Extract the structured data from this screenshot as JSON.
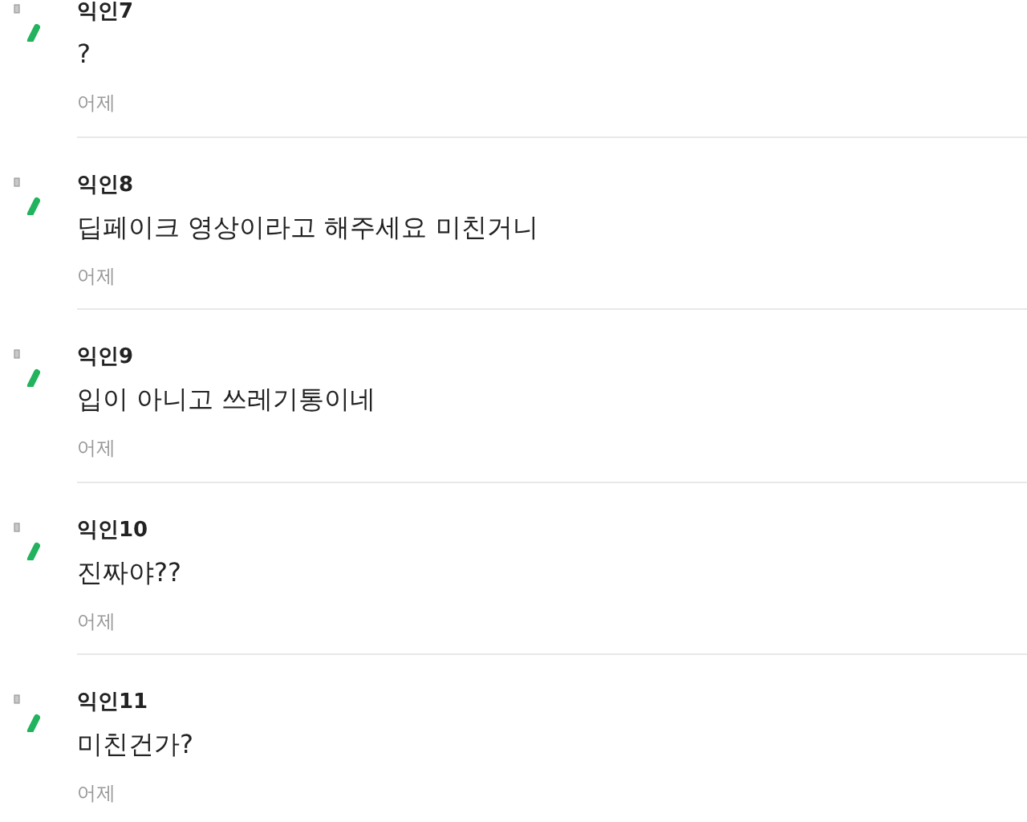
{
  "comments": [
    {
      "author": "익인7",
      "text": "?",
      "time": "어제"
    },
    {
      "author": "익인8",
      "text": "딥페이크 영상이라고 해주세요 미친거니",
      "time": "어제"
    },
    {
      "author": "익인9",
      "text": "입이 아니고 쓰레기통이네",
      "time": "어제"
    },
    {
      "author": "익인10",
      "text": "진짜야??",
      "time": "어제"
    },
    {
      "author": "익인11",
      "text": "미친건가?",
      "time": "어제"
    }
  ]
}
